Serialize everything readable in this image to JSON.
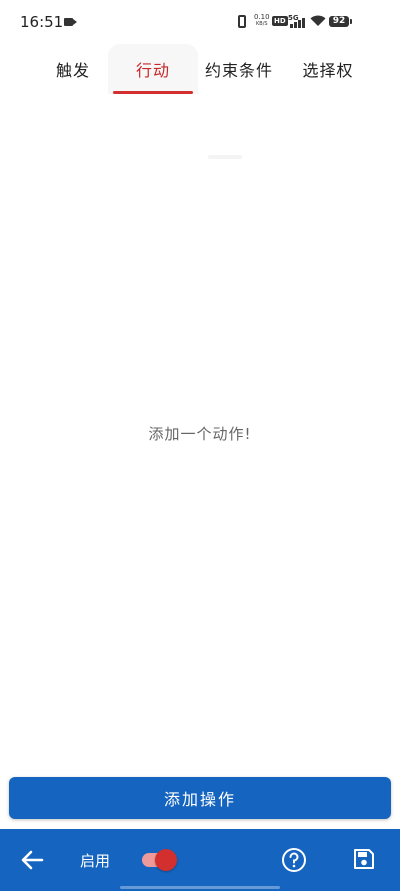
{
  "status_bar": {
    "time": "16:51",
    "net_speed_value": "0.10",
    "net_speed_unit": "KB/S",
    "hd_badge": "HD",
    "network_type": "5G",
    "battery": "92"
  },
  "tabs": [
    {
      "label": "触发"
    },
    {
      "label": "行动"
    },
    {
      "label": "约束条件"
    },
    {
      "label": "选择权"
    }
  ],
  "active_tab": "行动",
  "empty_state": "添加一个动作!",
  "add_button": "添加操作",
  "bottom_bar": {
    "enable_label": "启用",
    "toggle_on": true
  },
  "colors": {
    "accent_red": "#d32f2f",
    "primary_blue": "#1565c0"
  },
  "icons": [
    "video-camera-icon",
    "vibrate-icon",
    "signal-icon",
    "wifi-icon",
    "battery-icon",
    "arrow-left-icon",
    "help-circle-icon",
    "save-floppy-icon"
  ]
}
